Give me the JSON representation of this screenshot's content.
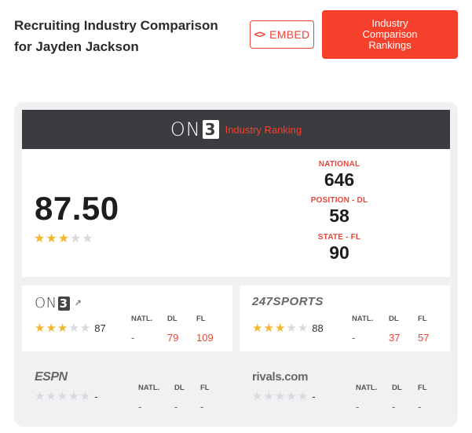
{
  "header": {
    "title": "Recruiting Industry Comparison for Jayden Jackson",
    "embed_label": "EMBED",
    "embed_icon": "code-icon",
    "rankings_label": "Industry Comparison Rankings"
  },
  "colors": {
    "accent": "#f5402c",
    "header_bg": "#3b3c40",
    "star": "#f0b72f",
    "star_empty": "#d9d9dd"
  },
  "industry": {
    "logo_text": "ON",
    "logo_box": "3",
    "label": "Industry Ranking",
    "score": "87.50",
    "stars": 3,
    "ranks": {
      "national_label": "NATIONAL",
      "national": "646",
      "position_label": "POSITION - DL",
      "position": "58",
      "state_label": "STATE - FL",
      "state": "90"
    }
  },
  "services": {
    "on3": {
      "logo_text": "ON",
      "logo_box": "3",
      "icon": "external-link-icon",
      "stars": 3,
      "score": "87",
      "natl_label": "NATL.",
      "natl": "-",
      "pos_label": "DL",
      "pos": "79",
      "state_label": "FL",
      "state": "109"
    },
    "sports247": {
      "logo": "247SPORTS",
      "stars": 3,
      "score": "88",
      "natl_label": "NATL.",
      "natl": "-",
      "pos_label": "DL",
      "pos": "37",
      "state_label": "FL",
      "state": "57"
    },
    "espn": {
      "logo": "ESPN",
      "stars": 0,
      "score": "-",
      "natl_label": "NATL.",
      "natl": "-",
      "pos_label": "DL",
      "pos": "-",
      "state_label": "FL",
      "state": "-"
    },
    "rivals": {
      "logo": "rivals.com",
      "stars": 0,
      "score": "-",
      "natl_label": "NATL.",
      "natl": "-",
      "pos_label": "DL",
      "pos": "-",
      "state_label": "FL",
      "state": "-"
    }
  }
}
